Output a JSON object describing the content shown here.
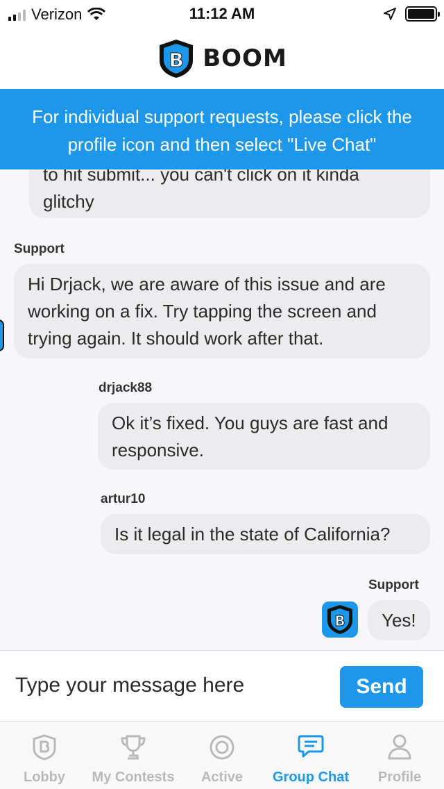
{
  "status_bar": {
    "carrier": "Verizon",
    "time": "11:12 AM"
  },
  "header": {
    "brand": "BOOM",
    "logo_letter": "B"
  },
  "banner": {
    "line1": "For individual support requests, please click the",
    "line2": "profile icon and then select \"Live Chat\""
  },
  "messages": [
    {
      "sender": "",
      "line1": "to hit submit... you can't click on it kinda",
      "line2": "glitchy"
    },
    {
      "sender": "Support",
      "line1": "Hi Drjack, we are aware of this issue and are",
      "line2": "working on a fix. Try tapping the screen and",
      "line3": "trying again. It should work after that."
    },
    {
      "sender": "drjack88",
      "line1": "Ok it’s fixed. You guys are fast and",
      "line2": "responsive."
    },
    {
      "sender": "artur10",
      "line1": "Is it legal in the state of California?"
    },
    {
      "sender": "Support",
      "line1": "Yes!"
    }
  ],
  "composer": {
    "placeholder": "Type your message here",
    "send_label": "Send"
  },
  "tabs": [
    {
      "label": "Lobby",
      "icon": "shield-b-icon",
      "active": false
    },
    {
      "label": "My Contests",
      "icon": "trophy-icon",
      "active": false
    },
    {
      "label": "Active",
      "icon": "target-icon",
      "active": false
    },
    {
      "label": "Group Chat",
      "icon": "chat-bubble-icon",
      "active": true
    },
    {
      "label": "Profile",
      "icon": "person-icon",
      "active": false
    }
  ],
  "colors": {
    "accent": "#1c97ea",
    "bubble": "#ececee",
    "inactive_tab": "#b9b9b9"
  }
}
